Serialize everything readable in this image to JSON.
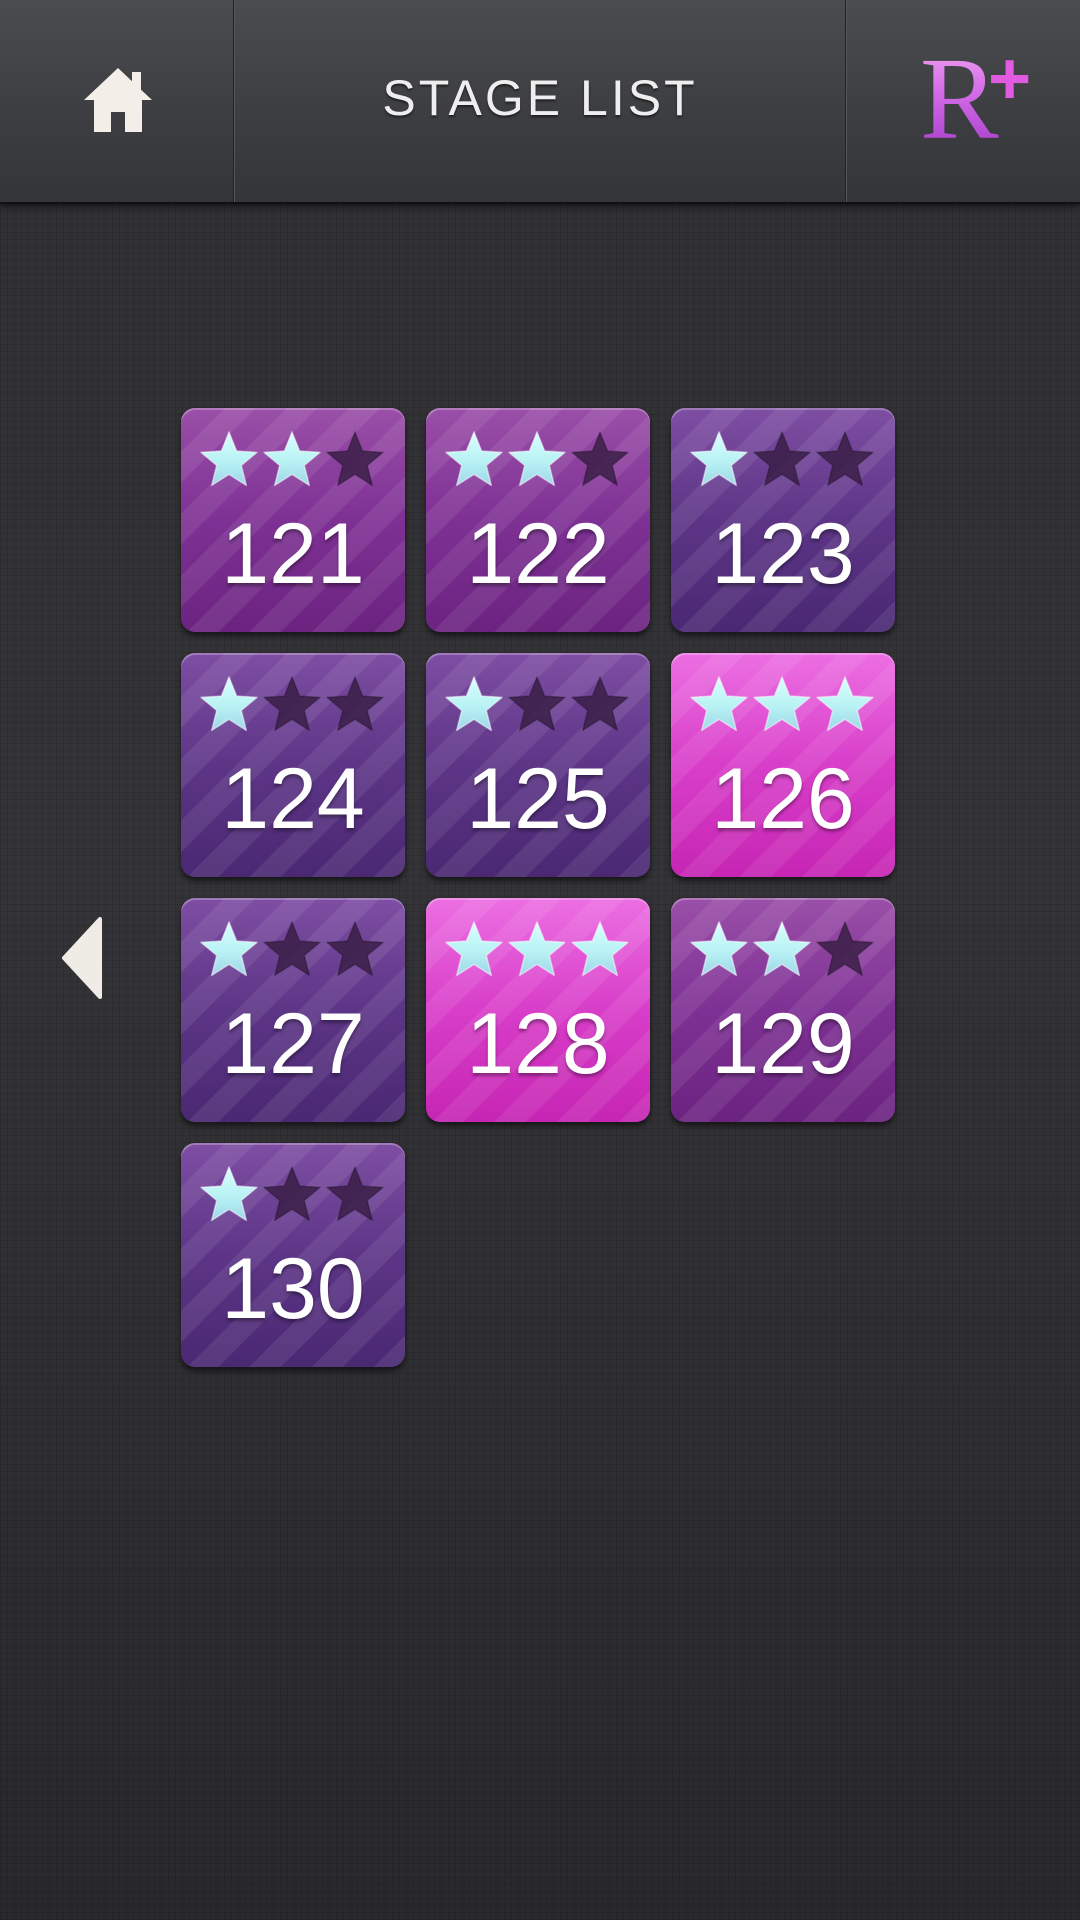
{
  "header": {
    "title": "STAGE LIST",
    "logo_letter": "R",
    "logo_plus": "+"
  },
  "icons": {
    "home": "home-icon",
    "back": "chevron-left-icon",
    "star_filled": "star-filled-icon",
    "star_empty": "star-empty-icon"
  },
  "colors": {
    "star_filled": "#b8f2f4",
    "star_empty": "#3a1e47",
    "tile_purple": "#7e3194",
    "tile_violet": "#5d3587",
    "tile_pink": "#d83ec9",
    "logo": "#d36ae6"
  },
  "stages": [
    {
      "number": "121",
      "stars": 2,
      "color": "purple"
    },
    {
      "number": "122",
      "stars": 2,
      "color": "purple"
    },
    {
      "number": "123",
      "stars": 1,
      "color": "violet"
    },
    {
      "number": "124",
      "stars": 1,
      "color": "violet"
    },
    {
      "number": "125",
      "stars": 1,
      "color": "violet"
    },
    {
      "number": "126",
      "stars": 3,
      "color": "pink"
    },
    {
      "number": "127",
      "stars": 1,
      "color": "violet"
    },
    {
      "number": "128",
      "stars": 3,
      "color": "pink"
    },
    {
      "number": "129",
      "stars": 2,
      "color": "purple"
    },
    {
      "number": "130",
      "stars": 1,
      "color": "violet"
    }
  ]
}
